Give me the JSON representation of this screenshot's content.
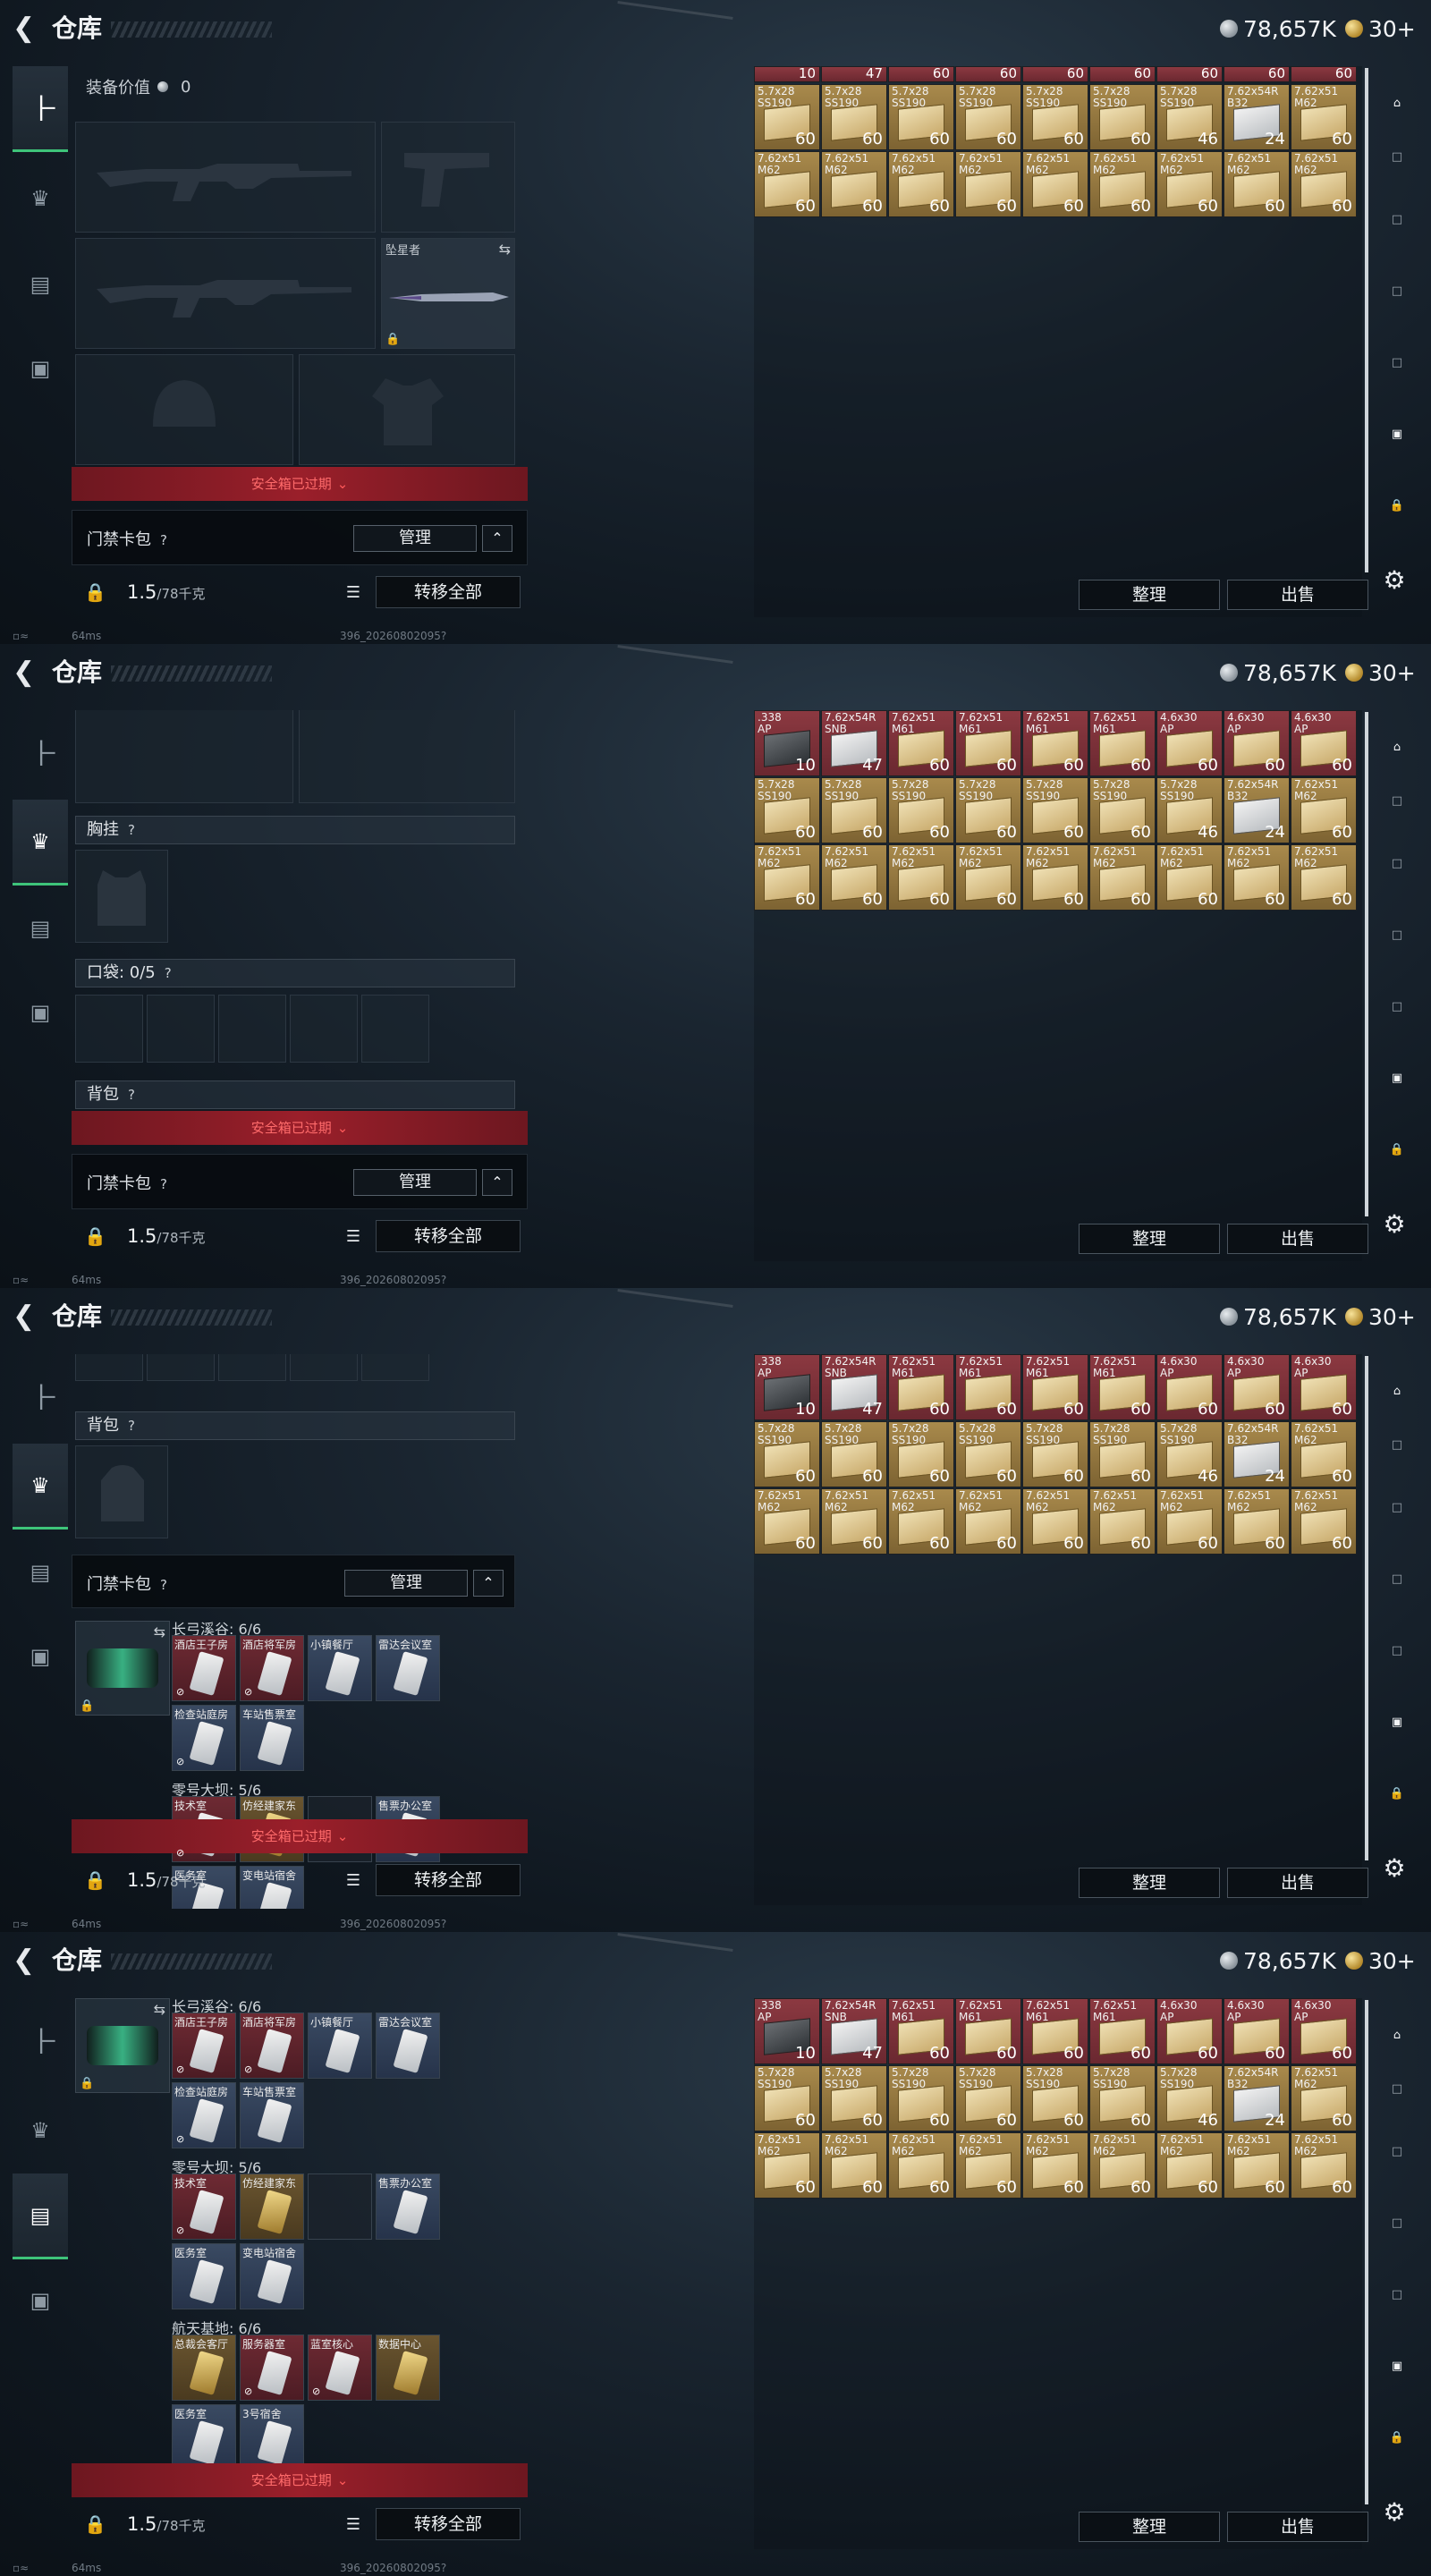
{
  "app": {
    "title": "仓库",
    "silver": "78,657K",
    "gold": "30+",
    "build": "396_20260802095?",
    "ping": "64ms"
  },
  "equip": {
    "value_label": "装备价值",
    "value": "0",
    "melee_name": "坠星者",
    "chest_label": "胸挂",
    "pockets_label": "口袋: 0/5",
    "backpack_label": "背包",
    "keycard_label": "门禁卡包",
    "manage": "管理"
  },
  "safe_box": "安全箱已过期",
  "weight": {
    "value": "1.5",
    "max": "/78千克"
  },
  "transfer_all": "转移全部",
  "sort": "整理",
  "sell": "出售",
  "maps": [
    {
      "title": "长弓溪谷: 6/6",
      "cards": [
        "酒店王子房",
        "酒店将军房",
        "小镇餐厅",
        "雷达会议室",
        "检查站庭房",
        "车站售票室"
      ]
    },
    {
      "title": "零号大坝: 5/6",
      "cards": [
        "技术室",
        "仿经建家东",
        "",
        "售票办公室",
        "医务室",
        "变电站宿舍"
      ]
    },
    {
      "title": "航天基地: 6/6",
      "cards": [
        "总裁会客厅",
        "服务器室",
        "蓝室核心",
        "数据中心",
        "医务室",
        "3号宿舍"
      ]
    }
  ],
  "storage": {
    "top_row": [
      {
        "name": ".338\nAP",
        "count": "10",
        "color": "red",
        "box": "dark"
      },
      {
        "name": "7.62x54R\nSNB",
        "count": "47",
        "color": "red",
        "box": "white"
      },
      {
        "name": "7.62x51\nM61",
        "count": "60",
        "color": "red",
        "box": "gold"
      },
      {
        "name": "7.62x51\nM61",
        "count": "60",
        "color": "red",
        "box": "gold"
      },
      {
        "name": "7.62x51\nM61",
        "count": "60",
        "color": "red",
        "box": "gold"
      },
      {
        "name": "7.62x51\nM61",
        "count": "60",
        "color": "red",
        "box": "gold"
      },
      {
        "name": "4.6x30\nAP",
        "count": "60",
        "color": "red",
        "box": "gold"
      },
      {
        "name": "4.6x30\nAP",
        "count": "60",
        "color": "red",
        "box": "gold"
      },
      {
        "name": "4.6x30\nAP",
        "count": "60",
        "color": "red",
        "box": "gold"
      }
    ],
    "mid_row": [
      {
        "name": "5.7x28\nSS190",
        "count": "60",
        "color": "gold",
        "box": "gold"
      },
      {
        "name": "5.7x28\nSS190",
        "count": "60",
        "color": "gold",
        "box": "gold"
      },
      {
        "name": "5.7x28\nSS190",
        "count": "60",
        "color": "gold",
        "box": "gold"
      },
      {
        "name": "5.7x28\nSS190",
        "count": "60",
        "color": "gold",
        "box": "gold"
      },
      {
        "name": "5.7x28\nSS190",
        "count": "60",
        "color": "gold",
        "box": "gold"
      },
      {
        "name": "5.7x28\nSS190",
        "count": "60",
        "color": "gold",
        "box": "gold"
      },
      {
        "name": "5.7x28\nSS190",
        "count": "46",
        "color": "gold",
        "box": "gold"
      },
      {
        "name": "7.62x54R\nB32",
        "count": "24",
        "color": "gold",
        "box": "white"
      },
      {
        "name": "7.62x51\nM62",
        "count": "60",
        "color": "gold",
        "box": "gold"
      }
    ],
    "bot_row": [
      {
        "name": "7.62x51\nM62",
        "count": "60",
        "color": "gold",
        "box": "gold"
      },
      {
        "name": "7.62x51\nM62",
        "count": "60",
        "color": "gold",
        "box": "gold"
      },
      {
        "name": "7.62x51\nM62",
        "count": "60",
        "color": "gold",
        "box": "gold"
      },
      {
        "name": "7.62x51\nM62",
        "count": "60",
        "color": "gold",
        "box": "gold"
      },
      {
        "name": "7.62x51\nM62",
        "count": "60",
        "color": "gold",
        "box": "gold"
      },
      {
        "name": "7.62x51\nM62",
        "count": "60",
        "color": "gold",
        "box": "gold"
      },
      {
        "name": "7.62x51\nM62",
        "count": "60",
        "color": "gold",
        "box": "gold"
      },
      {
        "name": "7.62x51\nM62",
        "count": "60",
        "color": "gold",
        "box": "gold"
      },
      {
        "name": "7.62x51\nM62",
        "count": "60",
        "color": "gold",
        "box": "gold"
      }
    ],
    "peek_counts": [
      "10",
      "47",
      "60",
      "60",
      "60",
      "60",
      "60",
      "60",
      "60"
    ]
  }
}
